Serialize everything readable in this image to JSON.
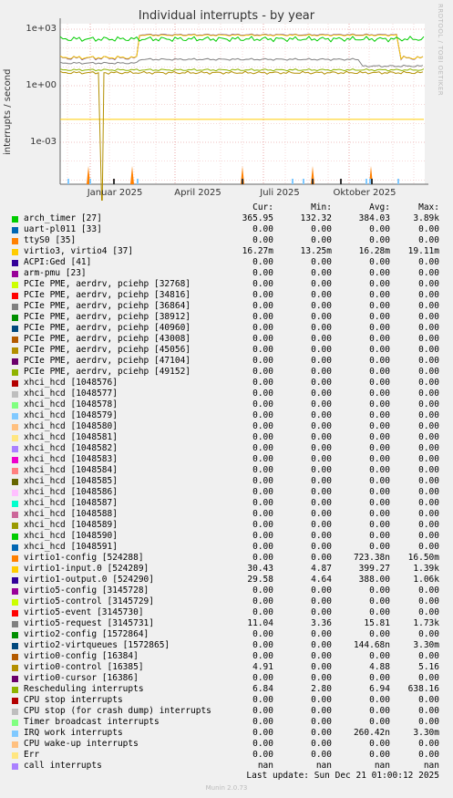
{
  "chart_data": {
    "type": "line",
    "title": "Individual interrupts - by year",
    "ylabel": "interrupts / second",
    "yscale": "log",
    "y_ticks": [
      "1e+03",
      "1e+00",
      "1e-03"
    ],
    "x_ticks": [
      "Januar 2025",
      "April 2025",
      "Juli 2025",
      "Oktober 2025"
    ],
    "grid": true,
    "series": [
      {
        "name": "arch_timer [27]",
        "color": "#00cc00",
        "cur": "365.95",
        "min": "132.32",
        "avg": "384.03",
        "max": "3.89k"
      },
      {
        "name": "uart-pl011 [33]",
        "color": "#0066b3",
        "cur": "0.00",
        "min": "0.00",
        "avg": "0.00",
        "max": "0.00"
      },
      {
        "name": "ttyS0 [35]",
        "color": "#ff8000",
        "cur": "0.00",
        "min": "0.00",
        "avg": "0.00",
        "max": "0.00"
      },
      {
        "name": "virtio3, virtio4 [37]",
        "color": "#ffcc00",
        "cur": "16.27m",
        "min": "13.25m",
        "avg": "16.28m",
        "max": "19.11m"
      },
      {
        "name": "ACPI:Ged [41]",
        "color": "#330099",
        "cur": "0.00",
        "min": "0.00",
        "avg": "0.00",
        "max": "0.00"
      },
      {
        "name": "arm-pmu [23]",
        "color": "#990099",
        "cur": "0.00",
        "min": "0.00",
        "avg": "0.00",
        "max": "0.00"
      },
      {
        "name": "PCIe PME, aerdrv, pciehp [32768]",
        "color": "#ccff00",
        "cur": "0.00",
        "min": "0.00",
        "avg": "0.00",
        "max": "0.00"
      },
      {
        "name": "PCIe PME, aerdrv, pciehp [34816]",
        "color": "#ff0000",
        "cur": "0.00",
        "min": "0.00",
        "avg": "0.00",
        "max": "0.00"
      },
      {
        "name": "PCIe PME, aerdrv, pciehp [36864]",
        "color": "#808080",
        "cur": "0.00",
        "min": "0.00",
        "avg": "0.00",
        "max": "0.00"
      },
      {
        "name": "PCIe PME, aerdrv, pciehp [38912]",
        "color": "#008f00",
        "cur": "0.00",
        "min": "0.00",
        "avg": "0.00",
        "max": "0.00"
      },
      {
        "name": "PCIe PME, aerdrv, pciehp [40960]",
        "color": "#00487d",
        "cur": "0.00",
        "min": "0.00",
        "avg": "0.00",
        "max": "0.00"
      },
      {
        "name": "PCIe PME, aerdrv, pciehp [43008]",
        "color": "#b35a00",
        "cur": "0.00",
        "min": "0.00",
        "avg": "0.00",
        "max": "0.00"
      },
      {
        "name": "PCIe PME, aerdrv, pciehp [45056]",
        "color": "#b38f00",
        "cur": "0.00",
        "min": "0.00",
        "avg": "0.00",
        "max": "0.00"
      },
      {
        "name": "PCIe PME, aerdrv, pciehp [47104]",
        "color": "#6b006b",
        "cur": "0.00",
        "min": "0.00",
        "avg": "0.00",
        "max": "0.00"
      },
      {
        "name": "PCIe PME, aerdrv, pciehp [49152]",
        "color": "#8fb300",
        "cur": "0.00",
        "min": "0.00",
        "avg": "0.00",
        "max": "0.00"
      },
      {
        "name": "xhci_hcd [1048576]",
        "color": "#b30000",
        "cur": "0.00",
        "min": "0.00",
        "avg": "0.00",
        "max": "0.00"
      },
      {
        "name": "xhci_hcd [1048577]",
        "color": "#bebebe",
        "cur": "0.00",
        "min": "0.00",
        "avg": "0.00",
        "max": "0.00"
      },
      {
        "name": "xhci_hcd [1048578]",
        "color": "#80ff80",
        "cur": "0.00",
        "min": "0.00",
        "avg": "0.00",
        "max": "0.00"
      },
      {
        "name": "xhci_hcd [1048579]",
        "color": "#80c9ff",
        "cur": "0.00",
        "min": "0.00",
        "avg": "0.00",
        "max": "0.00"
      },
      {
        "name": "xhci_hcd [1048580]",
        "color": "#ffc080",
        "cur": "0.00",
        "min": "0.00",
        "avg": "0.00",
        "max": "0.00"
      },
      {
        "name": "xhci_hcd [1048581]",
        "color": "#ffe680",
        "cur": "0.00",
        "min": "0.00",
        "avg": "0.00",
        "max": "0.00"
      },
      {
        "name": "xhci_hcd [1048582]",
        "color": "#aa80ff",
        "cur": "0.00",
        "min": "0.00",
        "avg": "0.00",
        "max": "0.00"
      },
      {
        "name": "xhci_hcd [1048583]",
        "color": "#ee00cc",
        "cur": "0.00",
        "min": "0.00",
        "avg": "0.00",
        "max": "0.00"
      },
      {
        "name": "xhci_hcd [1048584]",
        "color": "#ff8080",
        "cur": "0.00",
        "min": "0.00",
        "avg": "0.00",
        "max": "0.00"
      },
      {
        "name": "xhci_hcd [1048585]",
        "color": "#666600",
        "cur": "0.00",
        "min": "0.00",
        "avg": "0.00",
        "max": "0.00"
      },
      {
        "name": "xhci_hcd [1048586]",
        "color": "#ffbfff",
        "cur": "0.00",
        "min": "0.00",
        "avg": "0.00",
        "max": "0.00"
      },
      {
        "name": "xhci_hcd [1048587]",
        "color": "#00ffcc",
        "cur": "0.00",
        "min": "0.00",
        "avg": "0.00",
        "max": "0.00"
      },
      {
        "name": "xhci_hcd [1048588]",
        "color": "#cc6699",
        "cur": "0.00",
        "min": "0.00",
        "avg": "0.00",
        "max": "0.00"
      },
      {
        "name": "xhci_hcd [1048589]",
        "color": "#999900",
        "cur": "0.00",
        "min": "0.00",
        "avg": "0.00",
        "max": "0.00"
      },
      {
        "name": "xhci_hcd [1048590]",
        "color": "#00cc00",
        "cur": "0.00",
        "min": "0.00",
        "avg": "0.00",
        "max": "0.00"
      },
      {
        "name": "xhci_hcd [1048591]",
        "color": "#0066b3",
        "cur": "0.00",
        "min": "0.00",
        "avg": "0.00",
        "max": "0.00"
      },
      {
        "name": "virtio1-config [524288]",
        "color": "#ff8000",
        "cur": "0.00",
        "min": "0.00",
        "avg": "723.38n",
        "max": "16.50m"
      },
      {
        "name": "virtio1-input.0 [524289]",
        "color": "#ffcc00",
        "cur": "30.43",
        "min": "4.87",
        "avg": "399.27",
        "max": "1.39k"
      },
      {
        "name": "virtio1-output.0 [524290]",
        "color": "#330099",
        "cur": "29.58",
        "min": "4.64",
        "avg": "388.00",
        "max": "1.06k"
      },
      {
        "name": "virtio5-config [3145728]",
        "color": "#990099",
        "cur": "0.00",
        "min": "0.00",
        "avg": "0.00",
        "max": "0.00"
      },
      {
        "name": "virtio5-control [3145729]",
        "color": "#ccff00",
        "cur": "0.00",
        "min": "0.00",
        "avg": "0.00",
        "max": "0.00"
      },
      {
        "name": "virtio5-event [3145730]",
        "color": "#ff0000",
        "cur": "0.00",
        "min": "0.00",
        "avg": "0.00",
        "max": "0.00"
      },
      {
        "name": "virtio5-request [3145731]",
        "color": "#808080",
        "cur": "11.04",
        "min": "3.36",
        "avg": "15.81",
        "max": "1.73k"
      },
      {
        "name": "virtio2-config [1572864]",
        "color": "#008f00",
        "cur": "0.00",
        "min": "0.00",
        "avg": "0.00",
        "max": "0.00"
      },
      {
        "name": "virtio2-virtqueues [1572865]",
        "color": "#00487d",
        "cur": "0.00",
        "min": "0.00",
        "avg": "144.68n",
        "max": "3.30m"
      },
      {
        "name": "virtio0-config [16384]",
        "color": "#b35a00",
        "cur": "0.00",
        "min": "0.00",
        "avg": "0.00",
        "max": "0.00"
      },
      {
        "name": "virtio0-control [16385]",
        "color": "#b38f00",
        "cur": "4.91",
        "min": "0.00",
        "avg": "4.88",
        "max": "5.16"
      },
      {
        "name": "virtio0-cursor [16386]",
        "color": "#6b006b",
        "cur": "0.00",
        "min": "0.00",
        "avg": "0.00",
        "max": "0.00"
      },
      {
        "name": "Rescheduling interrupts",
        "color": "#8fb300",
        "cur": "6.84",
        "min": "2.80",
        "avg": "6.94",
        "max": "638.16"
      },
      {
        "name": "CPU stop interrupts",
        "color": "#b30000",
        "cur": "0.00",
        "min": "0.00",
        "avg": "0.00",
        "max": "0.00"
      },
      {
        "name": "CPU stop (for crash dump) interrupts",
        "color": "#bebebe",
        "cur": "0.00",
        "min": "0.00",
        "avg": "0.00",
        "max": "0.00"
      },
      {
        "name": "Timer broadcast interrupts",
        "color": "#80ff80",
        "cur": "0.00",
        "min": "0.00",
        "avg": "0.00",
        "max": "0.00"
      },
      {
        "name": "IRQ work interrupts",
        "color": "#80c9ff",
        "cur": "0.00",
        "min": "0.00",
        "avg": "260.42n",
        "max": "3.30m"
      },
      {
        "name": "CPU wake-up interrupts",
        "color": "#ffc080",
        "cur": "0.00",
        "min": "0.00",
        "avg": "0.00",
        "max": "0.00"
      },
      {
        "name": "Err",
        "color": "#ffe680",
        "cur": "0.00",
        "min": "0.00",
        "avg": "0.00",
        "max": "0.00"
      },
      {
        "name": "call interrupts",
        "color": "#aa80ff",
        "cur": "nan",
        "min": "nan",
        "avg": "nan",
        "max": "nan"
      }
    ]
  },
  "legend_header": {
    "cur": "Cur:",
    "min": "Min:",
    "avg": "Avg:",
    "max": "Max:"
  },
  "footer": {
    "last_update": "Last update: Sun Dec 21 01:00:12 2025",
    "munin": "Munin 2.0.73",
    "watermark": "RRDTOOL / TOBI OETIKER"
  }
}
